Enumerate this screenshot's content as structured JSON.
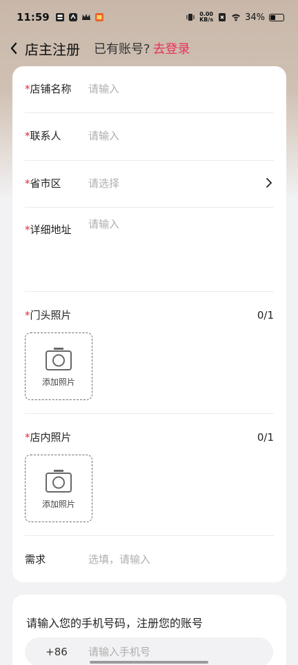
{
  "status_bar": {
    "time": "11:59",
    "net_speed_value": "0.00",
    "net_speed_unit": "KB/s",
    "battery": "34%"
  },
  "nav": {
    "title": "店主注册",
    "hint": "已有账号?",
    "login_link": "去登录"
  },
  "form": {
    "required_mark": "*",
    "store_name": {
      "label": "店铺名称",
      "placeholder": "请输入"
    },
    "contact": {
      "label": "联系人",
      "placeholder": "请输入"
    },
    "region": {
      "label": "省市区",
      "placeholder": "请选择"
    },
    "address": {
      "label": "详细地址",
      "placeholder": "请输入"
    },
    "front_photo": {
      "label": "门头照片",
      "count": "0/1",
      "add_label": "添加照片"
    },
    "inner_photo": {
      "label": "店内照片",
      "count": "0/1",
      "add_label": "添加照片"
    },
    "demand": {
      "label": "需求",
      "placeholder": "选填，请输入"
    }
  },
  "phone": {
    "title": "请输入您的手机号码，注册您的账号",
    "country_code": "+86",
    "placeholder": "请输入手机号"
  },
  "colors": {
    "accent": "#e8325a",
    "required": "#e02e2e"
  }
}
